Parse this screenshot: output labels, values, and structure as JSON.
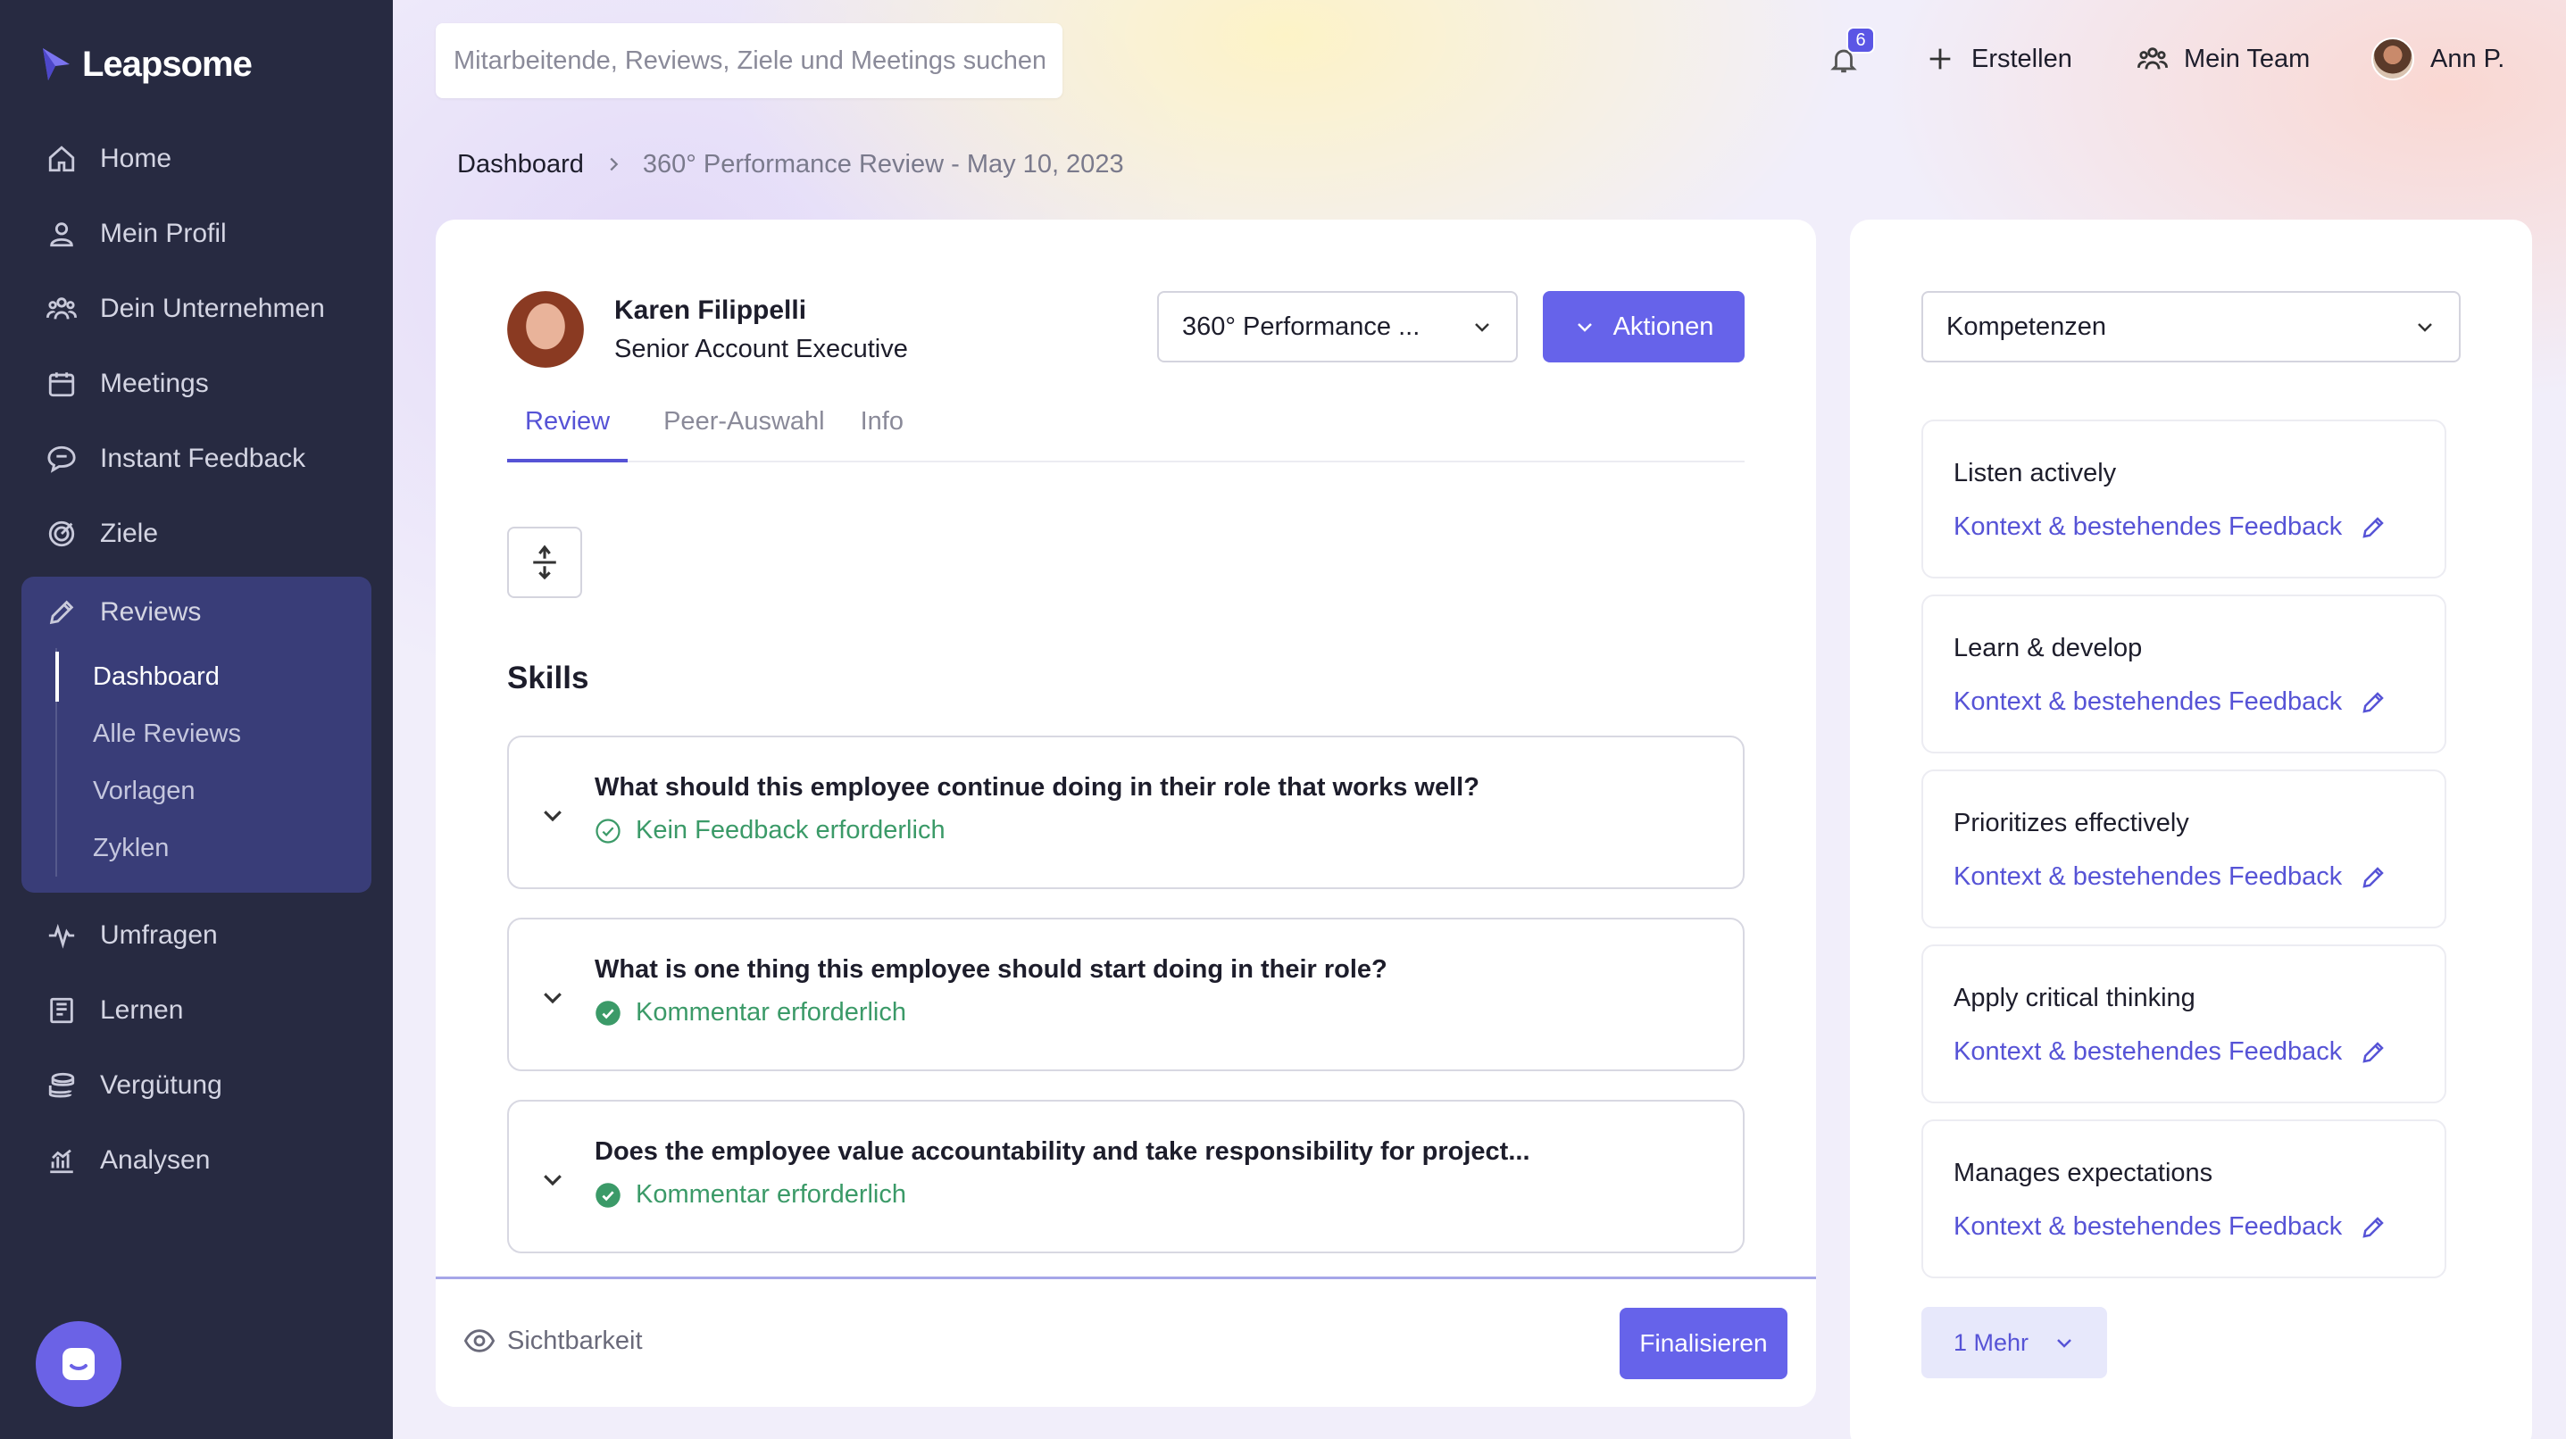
{
  "brand": {
    "name": "Leapsome"
  },
  "sidebar": {
    "items": [
      {
        "label": "Home",
        "icon": "home-icon"
      },
      {
        "label": "Mein Profil",
        "icon": "user-icon"
      },
      {
        "label": "Dein Unternehmen",
        "icon": "people-icon"
      },
      {
        "label": "Meetings",
        "icon": "calendar-icon"
      },
      {
        "label": "Instant Feedback",
        "icon": "chat-icon"
      },
      {
        "label": "Ziele",
        "icon": "target-icon"
      },
      {
        "label": "Reviews",
        "icon": "pencil-icon"
      },
      {
        "label": "Umfragen",
        "icon": "pulse-icon"
      },
      {
        "label": "Lernen",
        "icon": "book-icon"
      },
      {
        "label": "Vergütung",
        "icon": "coins-icon"
      },
      {
        "label": "Analysen",
        "icon": "chart-icon"
      }
    ],
    "reviews_sub": [
      "Dashboard",
      "Alle Reviews",
      "Vorlagen",
      "Zyklen"
    ],
    "active_sub": "Dashboard"
  },
  "topbar": {
    "search_placeholder": "Mitarbeitende, Reviews, Ziele und Meetings suchen",
    "notifications_count": "6",
    "create_label": "Erstellen",
    "team_label": "Mein Team",
    "user_label": "Ann P."
  },
  "breadcrumb": {
    "root": "Dashboard",
    "current": "360° Performance Review - May 10, 2023"
  },
  "review": {
    "person_name": "Karen Filippelli",
    "person_role": "Senior Account Executive",
    "review_select": "360° Performance ...",
    "actions_label": "Aktionen",
    "tabs": [
      "Review",
      "Peer-Auswahl",
      "Info"
    ],
    "active_tab": "Review",
    "section_title": "Skills",
    "questions": [
      {
        "text": "What should this employee continue doing in their role that works well?",
        "status": "Kein Feedback erforderlich",
        "status_type": "outline"
      },
      {
        "text": "What is one thing this employee should start doing in their role?",
        "status": "Kommentar erforderlich",
        "status_type": "filled"
      },
      {
        "text": "Does the employee value accountability and take responsibility for project...",
        "status": "Kommentar erforderlich",
        "status_type": "filled"
      }
    ],
    "visibility_label": "Sichtbarkeit",
    "finalize_label": "Finalisieren"
  },
  "competencies": {
    "select_label": "Kompetenzen",
    "link_label": "Kontext & bestehendes Feedback",
    "items": [
      "Listen actively",
      "Learn & develop",
      "Prioritizes effectively",
      "Apply critical thinking",
      "Manages expectations"
    ],
    "more_label": "1 Mehr"
  },
  "colors": {
    "sidebar_bg": "#272a41",
    "sidebar_active_group": "#393d78",
    "accent": "#6663ea",
    "link": "#5653d6",
    "success": "#3b9a68"
  }
}
